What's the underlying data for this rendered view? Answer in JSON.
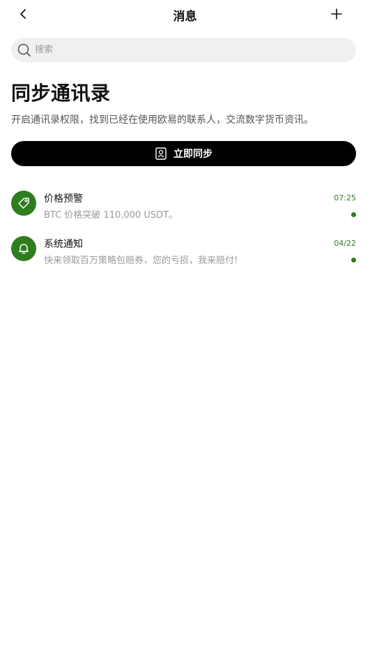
{
  "header": {
    "title": "消息"
  },
  "search": {
    "placeholder": "搜索"
  },
  "sync": {
    "title": "同步通讯录",
    "description": "开启通讯录权限，找到已经在使用欧易的联系人，交流数字货币资讯。",
    "button_label": "立即同步"
  },
  "messages": [
    {
      "title": "价格预警",
      "preview": "BTC 价格突破 110,000 USDT。",
      "time": "07:25",
      "unread": true,
      "icon": "price-tag-icon"
    },
    {
      "title": "系统通知",
      "preview": "快来领取百万策略包赔券，您的亏损，我来赔付!",
      "time": "04/22",
      "unread": true,
      "icon": "bell-icon"
    }
  ],
  "colors": {
    "accent": "#2e7d1f",
    "button_bg": "#000000",
    "search_bg": "#f0f0f0"
  }
}
